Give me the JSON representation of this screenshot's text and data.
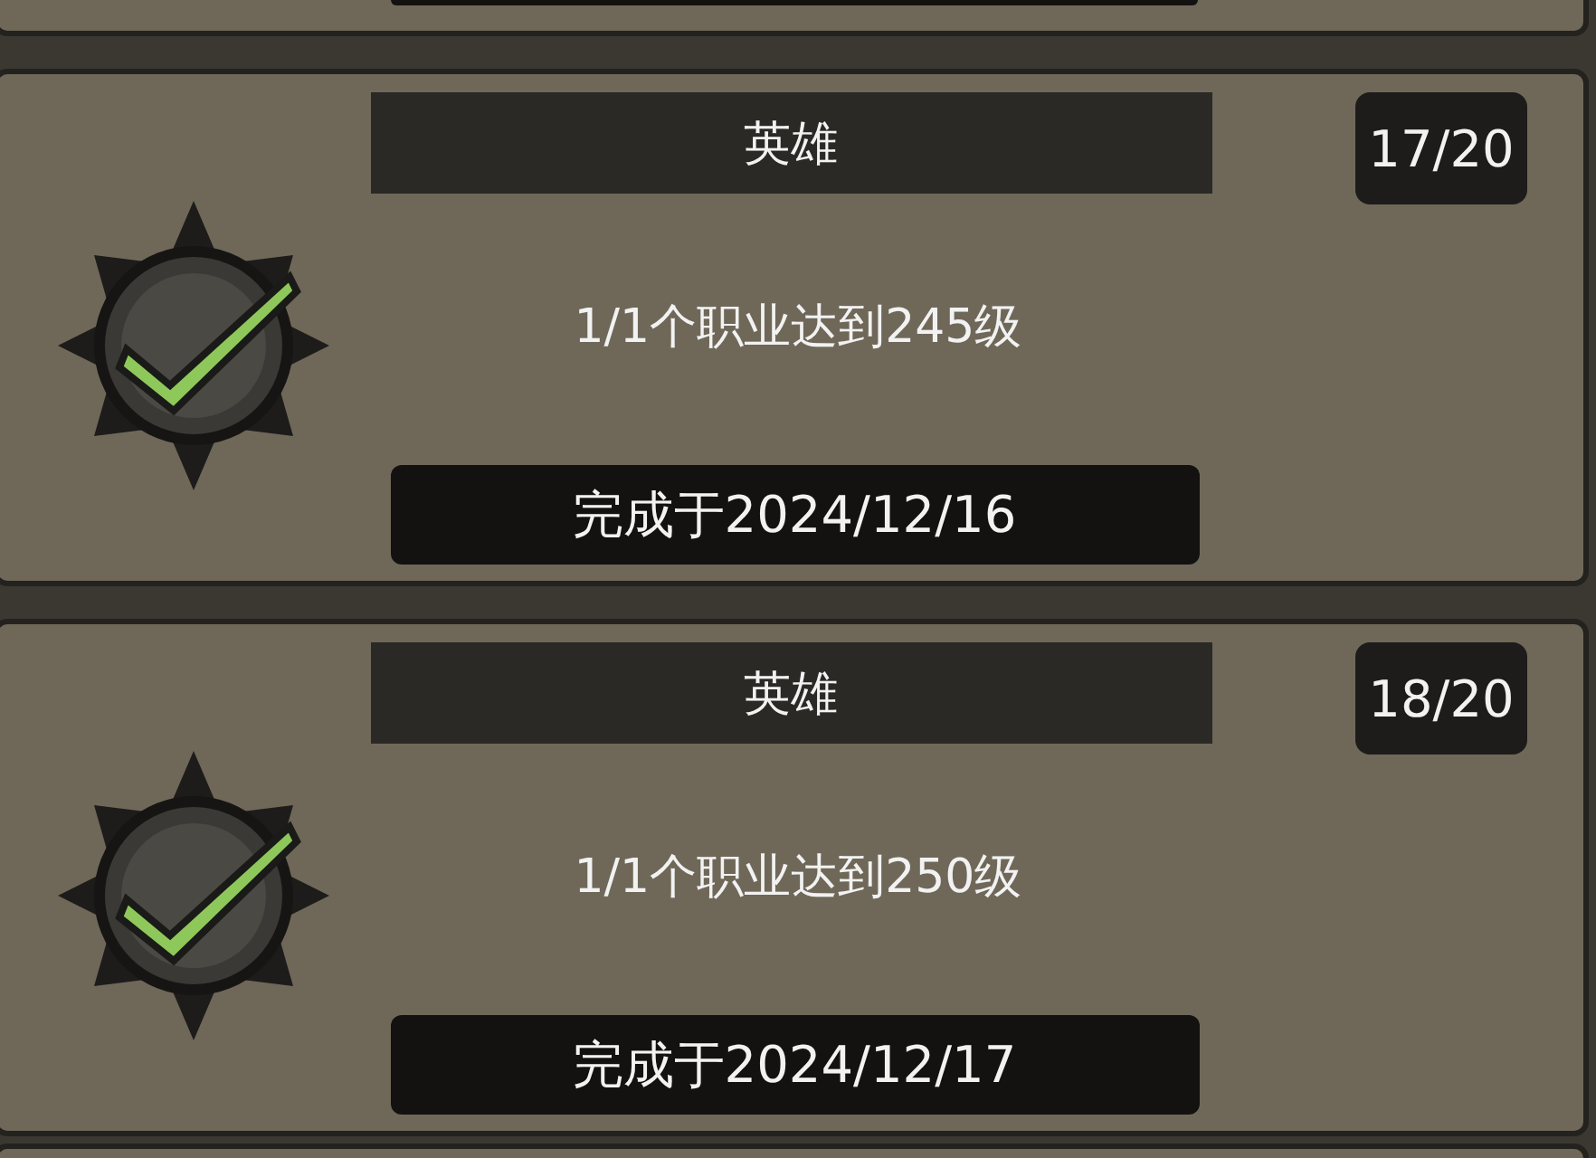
{
  "achievements": [
    {
      "title": "英雄",
      "progress": "17/20",
      "description": "1/1个职业达到245级",
      "completed_date": "完成于2024/12/16",
      "completed": true
    },
    {
      "title": "英雄",
      "progress": "18/20",
      "description": "1/1个职业达到250级",
      "completed_date": "完成于2024/12/17",
      "completed": true
    }
  ]
}
